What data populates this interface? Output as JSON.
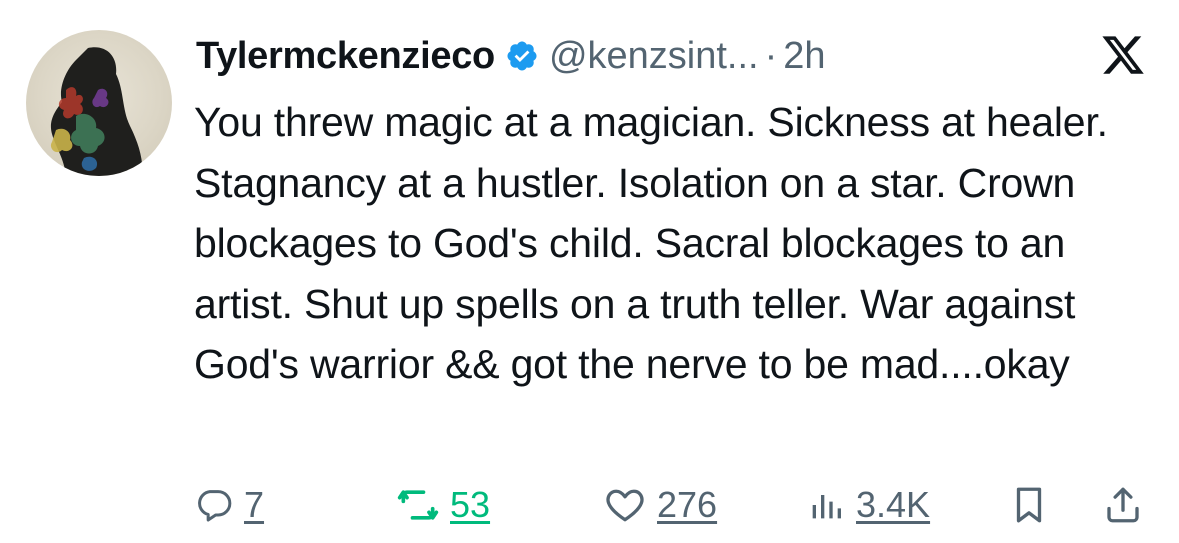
{
  "tweet": {
    "author_name": "Tylermckenzieco",
    "handle": "@kenzsint...",
    "separator": "·",
    "time": "2h",
    "text": "You threw magic at a magician. Sickness at healer. Stagnancy at a hustler. Isolation on a star. Crown blockages to God's child. Sacral blockages to an artist. Shut up spells on a truth teller. War against God's warrior && got the nerve to be mad....okay"
  },
  "actions": {
    "replies": "7",
    "reposts": "53",
    "likes": "276",
    "views": "3.4K"
  },
  "icons": {
    "verified": "verified-badge-icon",
    "platform": "x-logo-icon",
    "reply": "reply-icon",
    "repost": "repost-icon",
    "like": "heart-icon",
    "views": "views-icon",
    "bookmark": "bookmark-icon",
    "share": "share-icon"
  },
  "colors": {
    "text": "#0f1419",
    "secondary": "#536471",
    "verified": "#1d9bf0",
    "repost": "#00ba7c"
  }
}
